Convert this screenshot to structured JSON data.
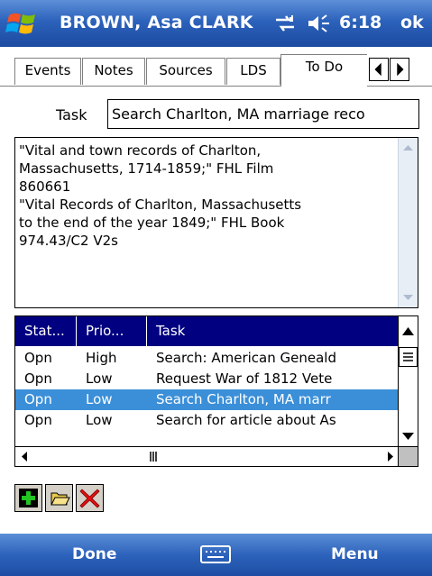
{
  "title_bar": {
    "title": "BROWN, Asa CLARK",
    "time": "6:18",
    "ok_label": "ok",
    "icons": [
      "windows-start-icon",
      "connectivity-icon",
      "volume-icon"
    ]
  },
  "tabs": [
    {
      "label": "Events",
      "active": false
    },
    {
      "label": "Notes",
      "active": false
    },
    {
      "label": "Sources",
      "active": false
    },
    {
      "label": "LDS",
      "active": false
    },
    {
      "label": "To Do",
      "active": true
    }
  ],
  "task": {
    "label": "Task",
    "value": "Search Charlton, MA marriage reco"
  },
  "notes": {
    "text": "\"Vital and town records of Charlton,\nMassachusetts, 1714-1859;\" FHL Film\n860661\n\"Vital Records of Charlton, Massachusetts\nto the end of the year 1849;\" FHL Book\n974.43/C2 V2s"
  },
  "grid": {
    "columns": [
      "Stat...",
      "Prio...",
      "Task"
    ],
    "rows": [
      {
        "status": "Opn",
        "priority": "High",
        "task": "Search: American Geneald",
        "selected": false
      },
      {
        "status": "Opn",
        "priority": "Low",
        "task": "Request War of 1812 Vete",
        "selected": false
      },
      {
        "status": "Opn",
        "priority": "Low",
        "task": "Search Charlton, MA marr",
        "selected": true
      },
      {
        "status": "Opn",
        "priority": "Low",
        "task": "Search for article about As",
        "selected": false
      }
    ],
    "selection_color": "#3b8fd8",
    "header_color": "#000080"
  },
  "toolbar": {
    "buttons": [
      "add-icon",
      "open-folder-icon",
      "delete-icon"
    ]
  },
  "menu_bar": {
    "left": "Done",
    "right": "Menu",
    "center_icon": "keyboard-icon"
  }
}
